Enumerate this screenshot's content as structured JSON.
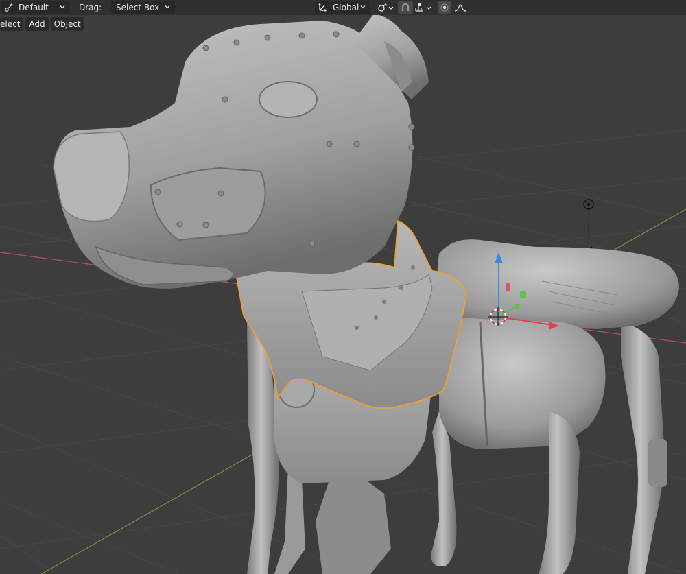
{
  "header": {
    "transform_pivot": {
      "value": "Default",
      "icon": "transform-pivot-icon"
    },
    "drag_label": "Drag:",
    "drag_mode": {
      "value": "Select Box"
    },
    "orientation": {
      "value": "Global",
      "icon": "transform-orientation-icon"
    },
    "snapping_icon": "magnet-icon",
    "proportional_editing_icon": "proportional-editing-icon"
  },
  "menus": {
    "select": "elect",
    "add": "Add",
    "object": "Object"
  },
  "colors": {
    "viewport_bg": "#3d3d3d",
    "grid_line": "#484848",
    "x_axis": "#b84f55",
    "y_axis": "#73a03b",
    "selection_outline": "#f0a030",
    "gizmo_x": "#e2424f",
    "gizmo_y": "#58c23a",
    "gizmo_z": "#3a8ae3"
  }
}
